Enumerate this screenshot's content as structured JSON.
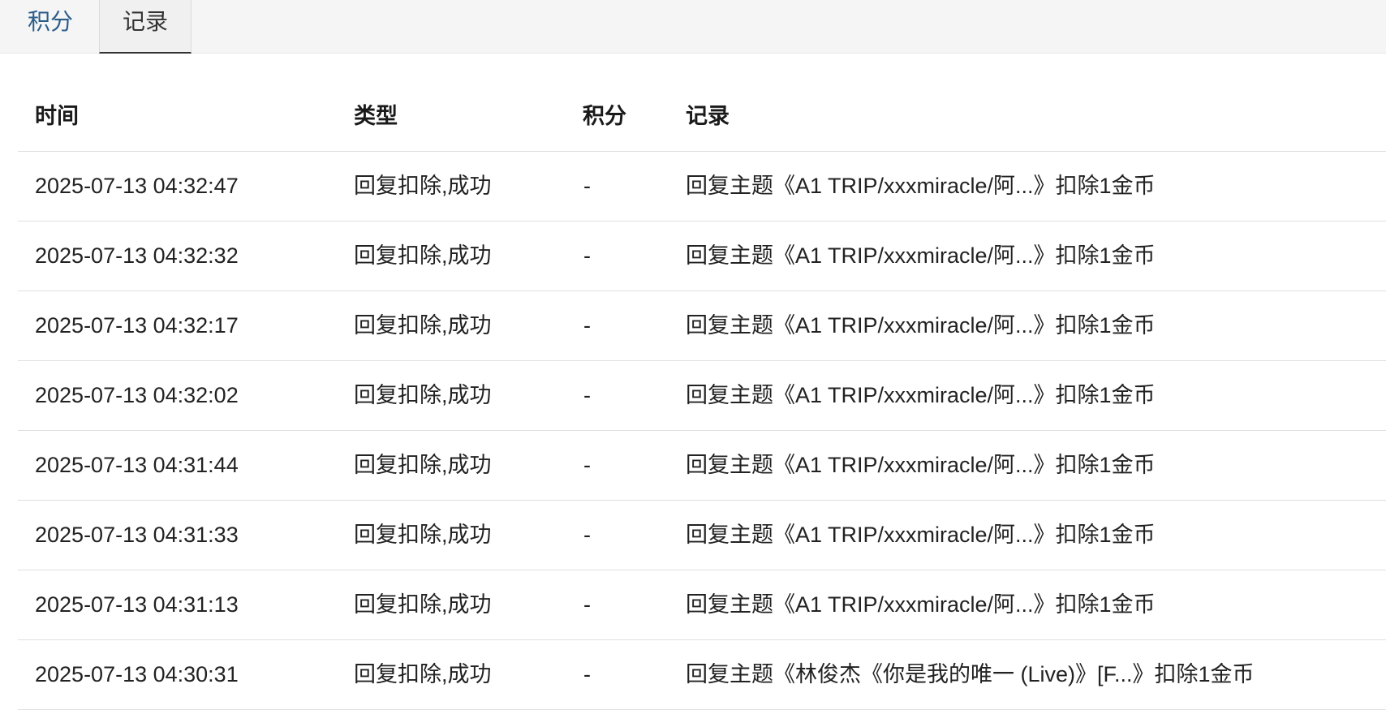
{
  "tabs": [
    {
      "label": "积分"
    },
    {
      "label": "记录"
    }
  ],
  "table": {
    "headers": {
      "time": "时间",
      "type": "类型",
      "points": "积分",
      "record": "记录"
    },
    "rows": [
      {
        "time": "2025-07-13 04:32:47",
        "type": "回复扣除,成功",
        "points": "-",
        "record": "回复主题《A1 TRIP/xxxmiracle/阿...》扣除1金币"
      },
      {
        "time": "2025-07-13 04:32:32",
        "type": "回复扣除,成功",
        "points": "-",
        "record": "回复主题《A1 TRIP/xxxmiracle/阿...》扣除1金币"
      },
      {
        "time": "2025-07-13 04:32:17",
        "type": "回复扣除,成功",
        "points": "-",
        "record": "回复主题《A1 TRIP/xxxmiracle/阿...》扣除1金币"
      },
      {
        "time": "2025-07-13 04:32:02",
        "type": "回复扣除,成功",
        "points": "-",
        "record": "回复主题《A1 TRIP/xxxmiracle/阿...》扣除1金币"
      },
      {
        "time": "2025-07-13 04:31:44",
        "type": "回复扣除,成功",
        "points": "-",
        "record": "回复主题《A1 TRIP/xxxmiracle/阿...》扣除1金币"
      },
      {
        "time": "2025-07-13 04:31:33",
        "type": "回复扣除,成功",
        "points": "-",
        "record": "回复主题《A1 TRIP/xxxmiracle/阿...》扣除1金币"
      },
      {
        "time": "2025-07-13 04:31:13",
        "type": "回复扣除,成功",
        "points": "-",
        "record": "回复主题《A1 TRIP/xxxmiracle/阿...》扣除1金币"
      },
      {
        "time": "2025-07-13 04:30:31",
        "type": "回复扣除,成功",
        "points": "-",
        "record": "回复主题《林俊杰《你是我的唯一 (Live)》[F...》扣除1金币"
      }
    ]
  }
}
